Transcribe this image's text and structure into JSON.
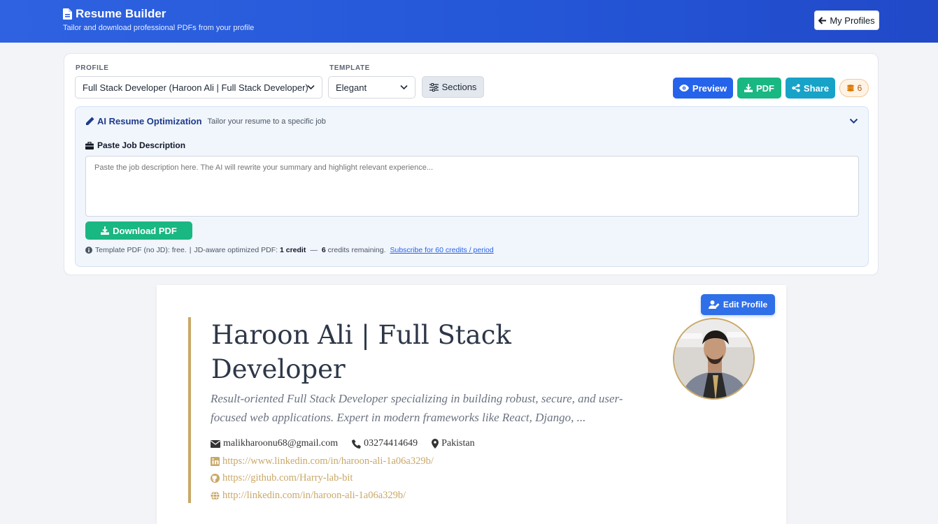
{
  "header": {
    "title": "Resume Builder",
    "subtitle": "Tailor and download professional PDFs from your profile",
    "my_profiles_label": "My Profiles"
  },
  "controls": {
    "profile_label": "PROFILE",
    "profile_value": "Full Stack Developer (Haroon Ali | Full Stack Developer)",
    "template_label": "TEMPLATE",
    "template_value": "Elegant",
    "sections_label": "Sections",
    "preview_label": "Preview",
    "pdf_label": "PDF",
    "share_label": "Share",
    "credits_count": "6"
  },
  "ai": {
    "title": "AI Resume Optimization",
    "subtitle": "Tailor your resume to a specific job",
    "jd_label": "Paste Job Description",
    "jd_placeholder": "Paste the job description here. The AI will rewrite your summary and highlight relevant experience...",
    "download_label": "Download PDF",
    "info_template": "Template PDF (no JD): free.",
    "info_pipe": "|",
    "info_jd": "JD-aware optimized PDF:",
    "info_cost": "1 credit",
    "info_dash": "—",
    "info_remaining_count": "6",
    "info_remaining_text": "credits remaining.",
    "subscribe_link": "Subscribe for 60 credits / period"
  },
  "resume": {
    "edit_label": "Edit Profile",
    "name": "Haroon Ali | Full Stack Developer",
    "summary": "Result-oriented Full Stack Developer specializing in building robust, secure, and user-focused web applications. Expert in modern frameworks like React, Django, ...",
    "email": "malikharoonu68@gmail.com",
    "phone": "03274414649",
    "location": "Pakistan",
    "linkedin": "https://www.linkedin.com/in/haroon-ali-1a06a329b/",
    "github": "https://github.com/Harry-lab-bit",
    "website": "http://linkedin.com/in/haroon-ali-1a06a329b/"
  },
  "colors": {
    "header_blue": "#2457d8",
    "primary_blue": "#2563eb",
    "green": "#19b781",
    "teal": "#17a2c8",
    "gold": "#c9a868"
  }
}
